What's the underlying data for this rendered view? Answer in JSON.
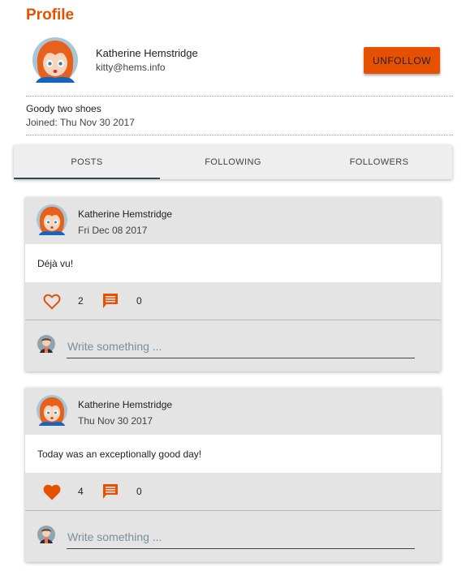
{
  "page": {
    "title": "Profile"
  },
  "profile": {
    "name": "Katherine Hemstridge",
    "email": "kitty@hems.info",
    "unfollow_label": "UNFOLLOW",
    "bio": "Goody two shoes",
    "joined": "Joined: Thu Nov 30 2017"
  },
  "tabs": [
    {
      "label": "POSTS",
      "active": true
    },
    {
      "label": "FOLLOWING",
      "active": false
    },
    {
      "label": "FOLLOWERS",
      "active": false
    }
  ],
  "posts": [
    {
      "author": "Katherine Hemstridge",
      "date": "Fri Dec 08 2017",
      "text": "Déjà vu!",
      "likes": "2",
      "liked": false,
      "comments": "0",
      "comment_placeholder": "Write something ..."
    },
    {
      "author": "Katherine Hemstridge",
      "date": "Thu Nov 30 2017",
      "text": "Today was an exceptionally good day!",
      "likes": "4",
      "liked": true,
      "comments": "0",
      "comment_placeholder": "Write something ..."
    }
  ],
  "colors": {
    "accent": "#e65100",
    "tab_indicator": "#37474f",
    "card_bg": "#e4e4e4"
  },
  "icons": {
    "like": "heart-icon",
    "comment": "comment-icon"
  }
}
